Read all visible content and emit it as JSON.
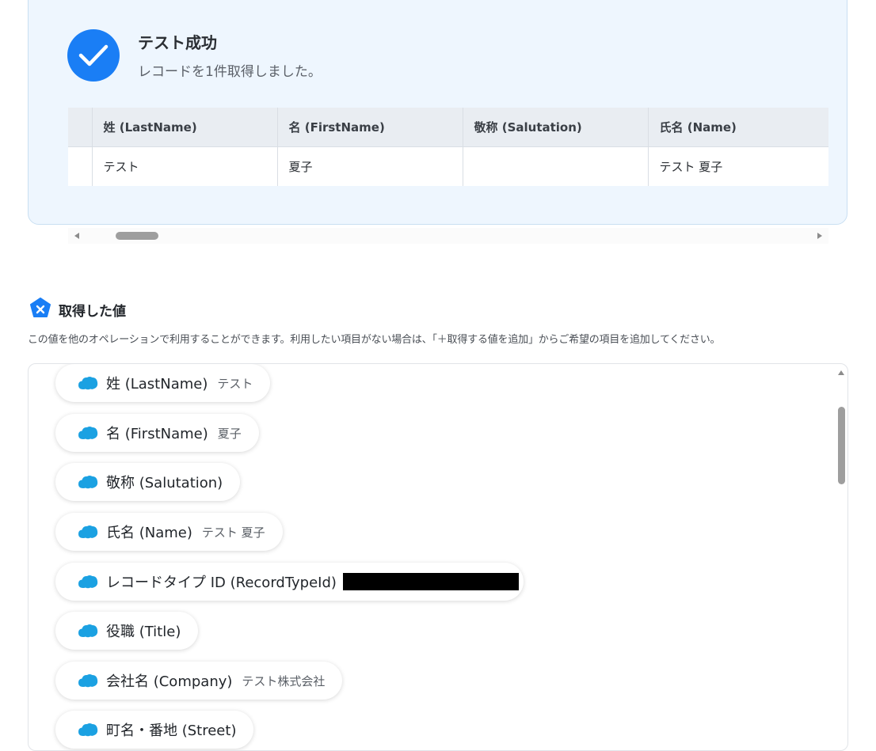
{
  "success": {
    "title": "テスト成功",
    "subtitle": "レコードを1件取得しました。"
  },
  "table": {
    "headers": [
      "",
      "姓 (LastName)",
      "名 (FirstName)",
      "敬称 (Salutation)",
      "氏名 (Name)"
    ],
    "rows": [
      [
        "",
        "テスト",
        "夏子",
        "",
        "テスト 夏子"
      ]
    ]
  },
  "values_section": {
    "title": "取得した値",
    "description": "この値を他のオペレーションで利用することができます。利用したい項目がない場合は、「＋取得する値を追加」からご希望の項目を追加してください。"
  },
  "fields": [
    {
      "label": "姓 (LastName)",
      "value": "テスト"
    },
    {
      "label": "名 (FirstName)",
      "value": "夏子"
    },
    {
      "label": "敬称 (Salutation)",
      "value": ""
    },
    {
      "label": "氏名 (Name)",
      "value": "テスト 夏子"
    },
    {
      "label": "レコードタイプ ID (RecordTypeId)",
      "value": ""
    },
    {
      "label": "役職 (Title)",
      "value": ""
    },
    {
      "label": "会社名 (Company)",
      "value": "テスト株式会社"
    },
    {
      "label": "町名・番地 (Street)",
      "value": ""
    }
  ],
  "colors": {
    "accent": "#1a7ef5",
    "salesforce_cloud": "#1ba1e2",
    "panel_bg": "#eef6fe"
  },
  "icons": {
    "success": "check-circle-icon",
    "values": "variable-hexagon-icon",
    "field": "salesforce-cloud-icon"
  }
}
